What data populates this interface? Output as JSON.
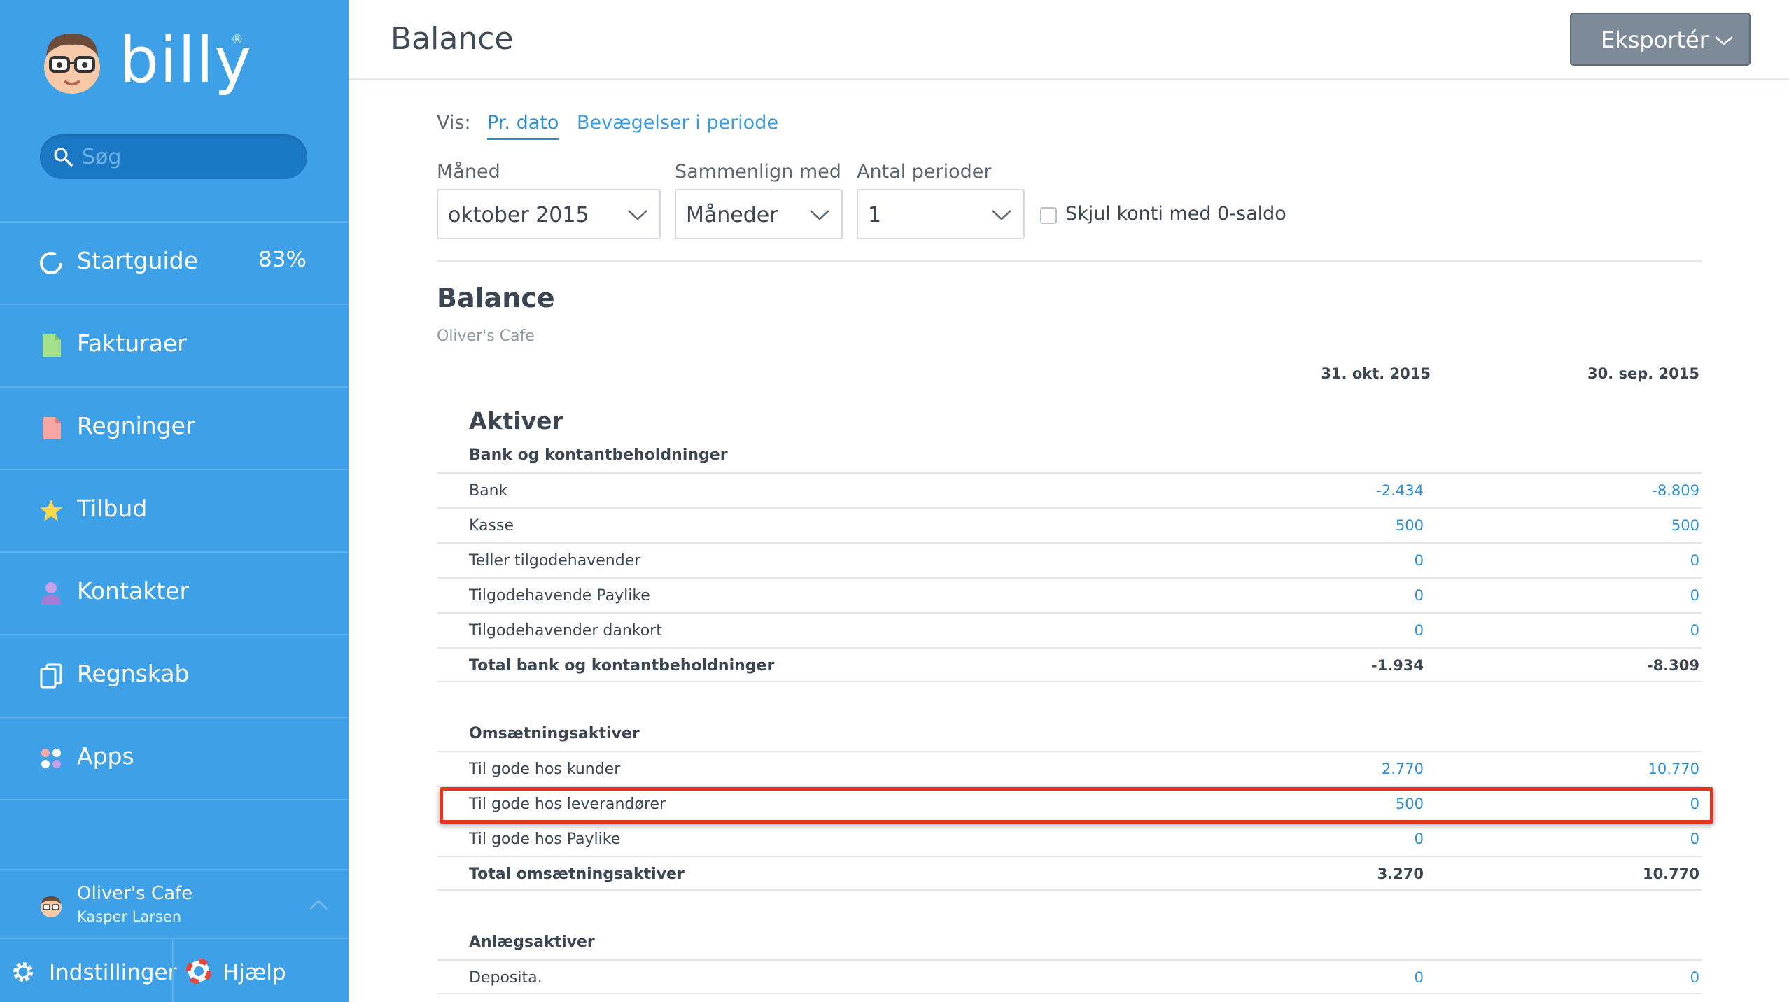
{
  "sidebar": {
    "brand": "billy",
    "brand_mark": "®",
    "search_placeholder": "Søg",
    "nav": [
      {
        "label": "Startguide",
        "icon": "progress-ring-icon",
        "percent": "83%"
      },
      {
        "label": "Fakturaer",
        "icon": "invoice-icon"
      },
      {
        "label": "Regninger",
        "icon": "bill-icon"
      },
      {
        "label": "Tilbud",
        "icon": "star-icon"
      },
      {
        "label": "Kontakter",
        "icon": "person-icon"
      },
      {
        "label": "Regnskab",
        "icon": "ledger-icon"
      },
      {
        "label": "Apps",
        "icon": "apps-icon"
      }
    ],
    "account": {
      "company": "Oliver's Cafe",
      "user": "Kasper Larsen"
    },
    "bottom": {
      "settings": "Indstillinger",
      "help": "Hjælp"
    }
  },
  "header": {
    "title": "Balance",
    "export_label": "Eksportér"
  },
  "view": {
    "label": "Vis:",
    "tabs": [
      "Pr. dato",
      "Bevægelser i periode"
    ],
    "active_tab": "Pr. dato"
  },
  "filters": {
    "month": {
      "label": "Måned",
      "value": "oktober 2015"
    },
    "compare": {
      "label": "Sammenlign med",
      "value": "Måneder"
    },
    "periods": {
      "label": "Antal perioder",
      "value": "1"
    },
    "hide_zero": {
      "label": "Skjul konti med 0-saldo",
      "checked": false
    }
  },
  "report": {
    "title": "Balance",
    "company": "Oliver's Cafe",
    "columns": [
      "31. okt. 2015",
      "30. sep. 2015"
    ],
    "section": "Aktiver",
    "groups": [
      {
        "name": "Bank og kontantbeholdninger",
        "rows": [
          {
            "label": "Bank",
            "v1": "-2.434",
            "v2": "-8.809"
          },
          {
            "label": "Kasse",
            "v1": "500",
            "v2": "500"
          },
          {
            "label": "Teller tilgodehavender",
            "v1": "0",
            "v2": "0"
          },
          {
            "label": "Tilgodehavende Paylike",
            "v1": "0",
            "v2": "0"
          },
          {
            "label": "Tilgodehavender dankort",
            "v1": "0",
            "v2": "0"
          }
        ],
        "total": {
          "label": "Total bank og kontantbeholdninger",
          "v1": "-1.934",
          "v2": "-8.309"
        }
      },
      {
        "name": "Omsætningsaktiver",
        "rows": [
          {
            "label": "Til gode hos kunder",
            "v1": "2.770",
            "v2": "10.770"
          },
          {
            "label": "Til gode hos leverandører",
            "v1": "500",
            "v2": "0"
          },
          {
            "label": "Til gode hos Paylike",
            "v1": "0",
            "v2": "0"
          }
        ],
        "total": {
          "label": "Total omsætningsaktiver",
          "v1": "3.270",
          "v2": "10.770"
        }
      },
      {
        "name": "Anlægsaktiver",
        "rows": [
          {
            "label": "Deposita.",
            "v1": "0",
            "v2": "0"
          }
        ]
      }
    ]
  },
  "colors": {
    "sidebar": "#3ea0e6",
    "link": "#2c8fd6",
    "highlight": "#e8331f",
    "export_button": "#7d8b98"
  }
}
